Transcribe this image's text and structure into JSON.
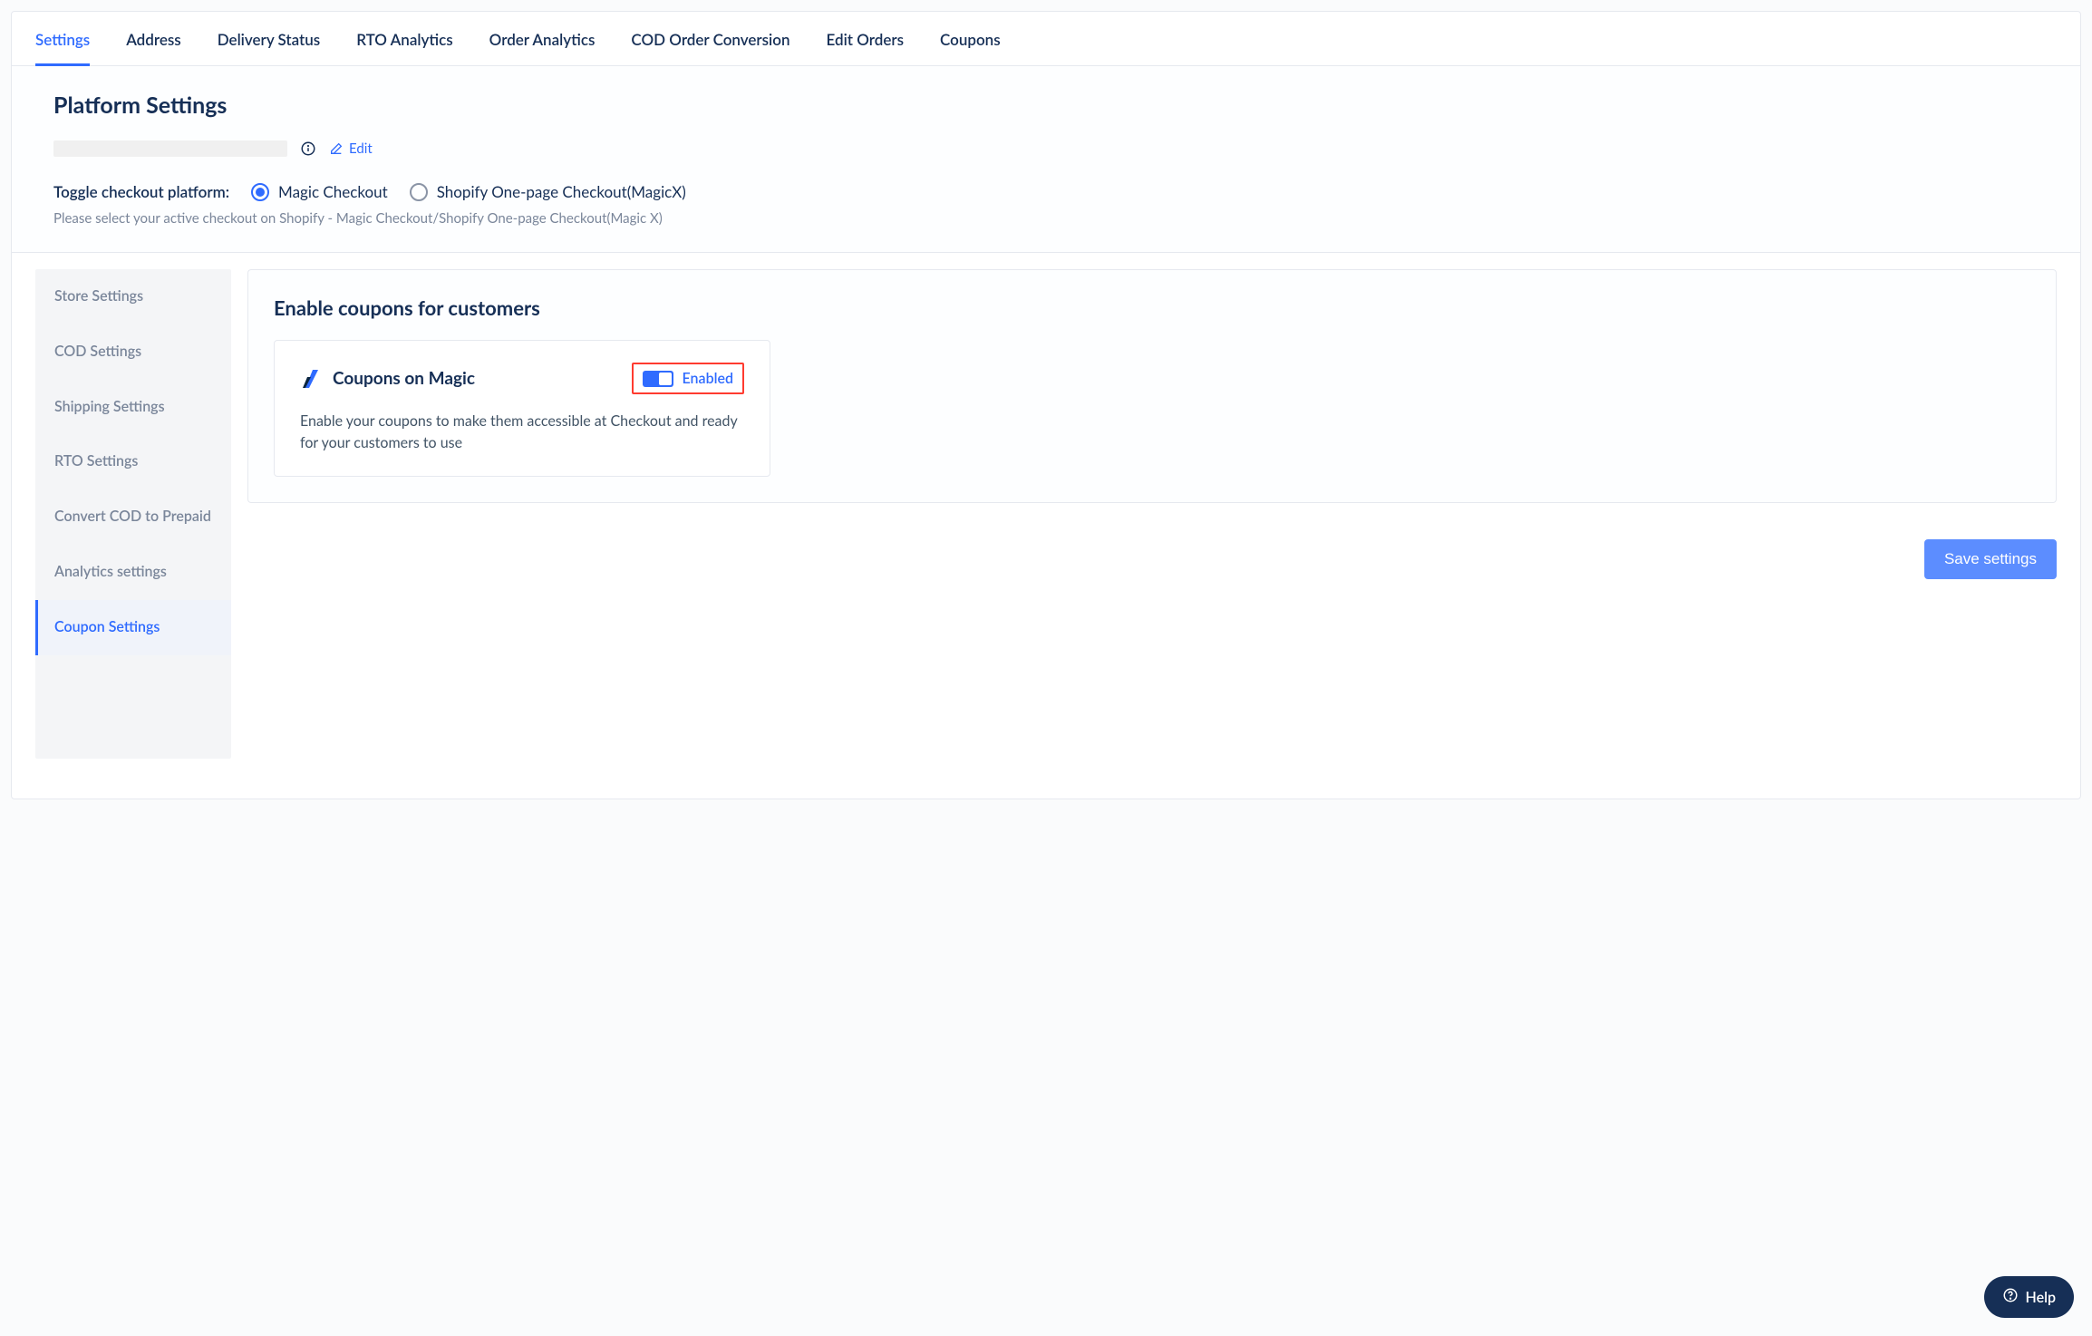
{
  "tabs": [
    {
      "label": "Settings",
      "active": true
    },
    {
      "label": "Address"
    },
    {
      "label": "Delivery Status"
    },
    {
      "label": "RTO Analytics"
    },
    {
      "label": "Order Analytics"
    },
    {
      "label": "COD Order Conversion"
    },
    {
      "label": "Edit Orders"
    },
    {
      "label": "Coupons"
    }
  ],
  "platform": {
    "title": "Platform Settings",
    "edit": "Edit",
    "toggle_label": "Toggle checkout platform:",
    "options": [
      {
        "label": "Magic Checkout",
        "selected": true
      },
      {
        "label": "Shopify One-page Checkout(MagicX)",
        "selected": false
      }
    ],
    "helper": "Please select your active checkout on Shopify - Magic Checkout/Shopify One-page Checkout(Magic X)"
  },
  "sidebar": {
    "items": [
      {
        "label": "Store Settings"
      },
      {
        "label": "COD Settings"
      },
      {
        "label": "Shipping Settings"
      },
      {
        "label": "RTO Settings"
      },
      {
        "label": "Convert COD to Prepaid"
      },
      {
        "label": "Analytics settings"
      },
      {
        "label": "Coupon Settings",
        "active": true
      }
    ]
  },
  "panel": {
    "title": "Enable coupons for customers",
    "feature_title": "Coupons on Magic",
    "toggle_state": "Enabled",
    "feature_desc": "Enable your coupons to make them accessible at Checkout and ready for your customers to use"
  },
  "save_button": "Save settings",
  "help": "Help"
}
